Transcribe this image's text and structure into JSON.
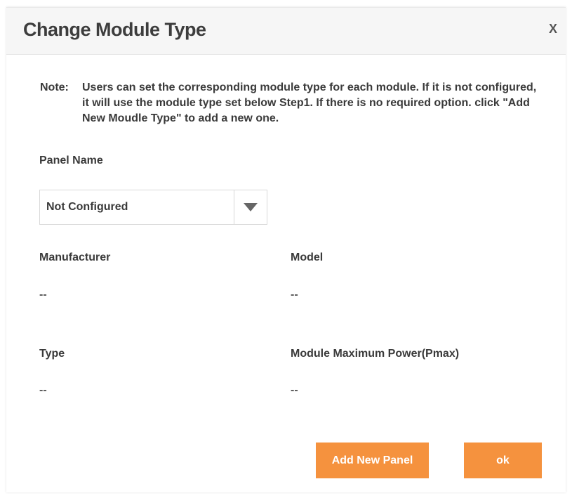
{
  "dialog": {
    "title": "Change Module Type",
    "close_label": "X"
  },
  "note": {
    "label": "Note:",
    "text": "Users can set the corresponding module type for each module. If it is not configured, it will use the module type set below Step1. If there is no required option. click \"Add New Moudle Type\" to add a new one."
  },
  "panel_name": {
    "label": "Panel Name",
    "selected": "Not Configured"
  },
  "fields": {
    "manufacturer": {
      "label": "Manufacturer",
      "value": "--"
    },
    "model": {
      "label": "Model",
      "value": "--"
    },
    "type": {
      "label": "Type",
      "value": "--"
    },
    "pmax": {
      "label": "Module Maximum Power(Pmax)",
      "value": "--"
    }
  },
  "buttons": {
    "add_new_panel": "Add New Panel",
    "ok": "ok"
  },
  "colors": {
    "accent": "#f5923e",
    "header_bg": "#f6f6f6",
    "text": "#3a3a3a"
  }
}
